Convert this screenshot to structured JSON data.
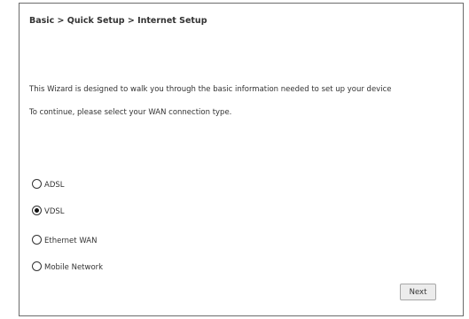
{
  "breadcrumb": "Basic > Quick Setup > Internet Setup",
  "intro": {
    "line1": "This Wizard is designed to walk you through the basic information needed to set up your device",
    "line2": "To continue, please select your WAN connection type."
  },
  "wan_types": [
    {
      "label": "ADSL",
      "selected": false
    },
    {
      "label": "VDSL",
      "selected": true
    },
    {
      "label": "Ethernet WAN",
      "selected": false
    },
    {
      "label": "Mobile Network",
      "selected": false
    }
  ],
  "next_label": "Next",
  "colors": {
    "border": "#6b6b6b",
    "text": "#333333",
    "button_bg": "#ececec"
  }
}
